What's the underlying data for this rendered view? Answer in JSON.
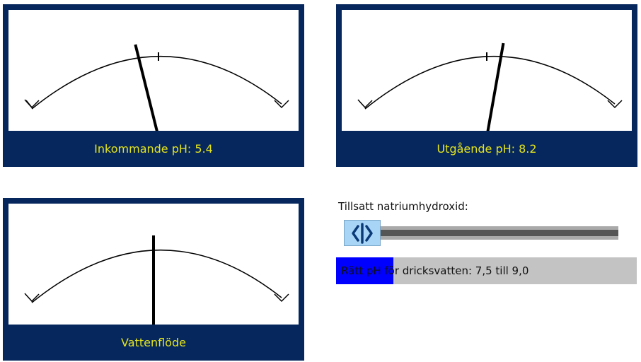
{
  "meters": [
    {
      "id": "incoming-ph",
      "label": "Inkommande pH: 5.4",
      "needle_angle_deg": -14
    },
    {
      "id": "outgoing-ph",
      "label": "Utgående pH: 8.2",
      "needle_angle_deg": 10
    },
    {
      "id": "water-flow",
      "label": "Vattenflöde",
      "needle_angle_deg": 0
    }
  ],
  "slider": {
    "label": "Tillsatt natriumhydroxid:",
    "value_fraction": 0.0,
    "thumb_icon": "left-right-arrows-icon"
  },
  "info": {
    "text": "Rätt pH för dricksvatten: 7,5 till 9,0",
    "fill_fraction": 0.19
  },
  "colors": {
    "panel": "#06275d",
    "caption": "#e4e41a",
    "thumb": "#a8d5f5",
    "fill": "#0000ff"
  }
}
